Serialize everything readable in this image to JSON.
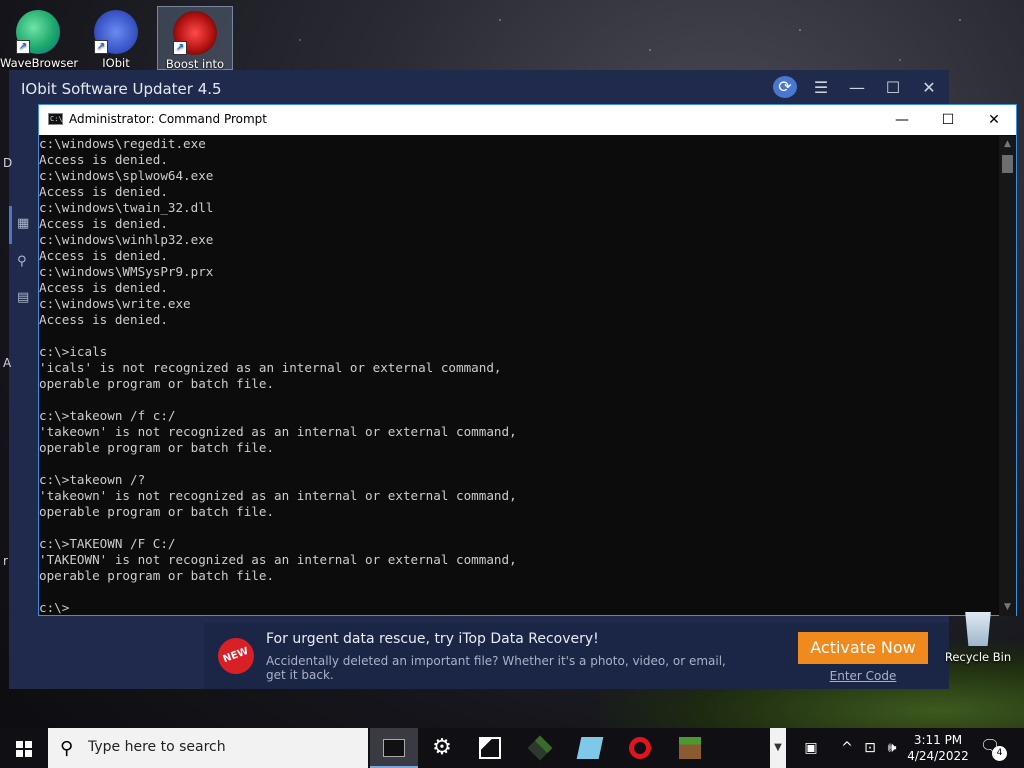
{
  "desktop": {
    "icons": [
      {
        "label": "WaveBrowser",
        "icon": "wavebrowser-icon",
        "color": "#1ea86b"
      },
      {
        "label": "IObit",
        "icon": "iobit-icon",
        "color": "#3a56c8"
      },
      {
        "label": "Boost into",
        "icon": "boost-icon",
        "color": "#d81b1b"
      }
    ],
    "recycle_bin": "Recycle Bin"
  },
  "iobit_window": {
    "title": "IObit Software Updater 4.5",
    "side_letters": [
      "D",
      "A",
      "r"
    ],
    "promo": {
      "badge": "NEW",
      "title": "For urgent data rescue, try iTop Data Recovery!",
      "text": "Accidentally deleted an important file? Whether it's a photo, video, or email, get it back.",
      "activate_label": "Activate Now",
      "enter_code_label": "Enter Code"
    }
  },
  "cmd_window": {
    "title": "Administrator: Command Prompt",
    "lines": [
      "c:\\windows\\regedit.exe",
      "Access is denied.",
      "c:\\windows\\splwow64.exe",
      "Access is denied.",
      "c:\\windows\\twain_32.dll",
      "Access is denied.",
      "c:\\windows\\winhlp32.exe",
      "Access is denied.",
      "c:\\windows\\WMSysPr9.prx",
      "Access is denied.",
      "c:\\windows\\write.exe",
      "Access is denied.",
      "",
      "c:\\>icals",
      "'icals' is not recognized as an internal or external command,",
      "operable program or batch file.",
      "",
      "c:\\>takeown /f c:/",
      "'takeown' is not recognized as an internal or external command,",
      "operable program or batch file.",
      "",
      "c:\\>takeown /?",
      "'takeown' is not recognized as an internal or external command,",
      "operable program or batch file.",
      "",
      "c:\\>TAKEOWN /F C:/",
      "'TAKEOWN' is not recognized as an internal or external command,",
      "operable program or batch file.",
      "",
      "c:\\>"
    ]
  },
  "taskbar": {
    "search_placeholder": "Type here to search",
    "time": "3:11 PM",
    "date": "4/24/2022",
    "notification_count": "4"
  }
}
